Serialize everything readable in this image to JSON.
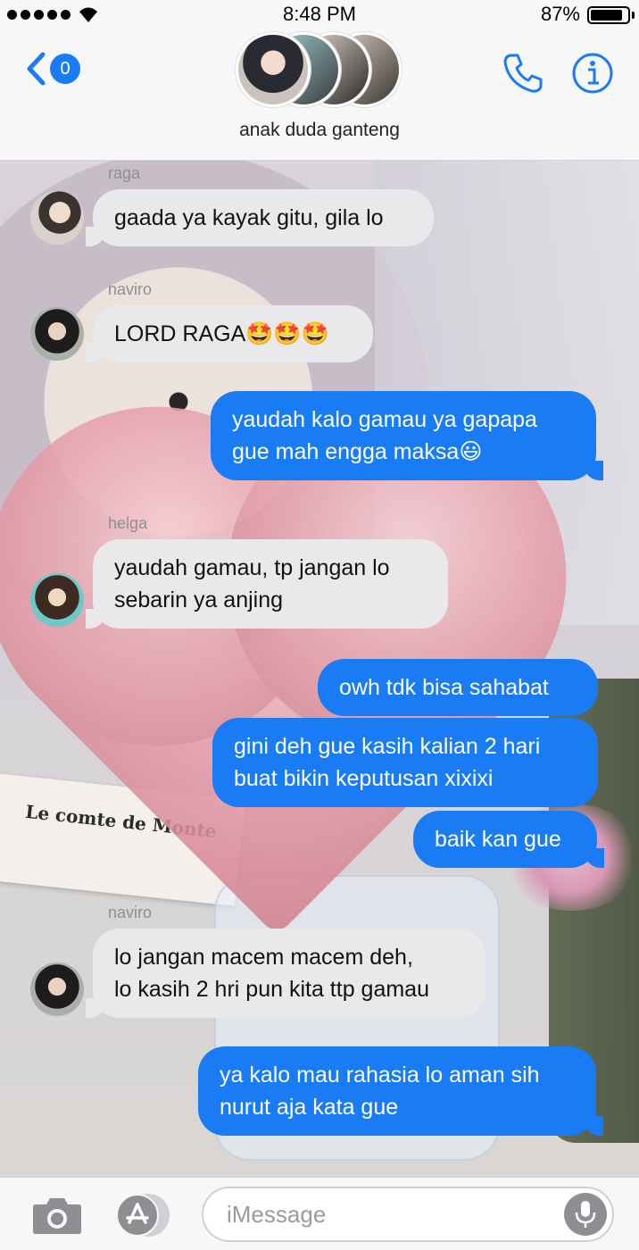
{
  "status": {
    "time": "8:48 PM",
    "battery_percent": "87%",
    "battery_level": 0.87
  },
  "header": {
    "back_badge": "0",
    "group_name": "anak duda ganteng"
  },
  "messages": [
    {
      "sender": "raga",
      "text": "gaada ya kayak gitu, gila lo",
      "side": "in"
    },
    {
      "sender": "naviro",
      "text": "LORD RAGA🤩🤩🤩",
      "side": "in"
    },
    {
      "text": "yaudah kalo gamau ya gapapa\ngue mah engga maksa😃",
      "side": "out"
    },
    {
      "sender": "helga",
      "text": "yaudah gamau, tp jangan lo\nsebarin ya anjing",
      "side": "in"
    },
    {
      "text": "owh tdk bisa sahabat",
      "side": "out"
    },
    {
      "text": "gini deh gue kasih kalian 2 hari\nbuat bikin keputusan xixixi",
      "side": "out"
    },
    {
      "text": "baik kan gue",
      "side": "out"
    },
    {
      "sender": "naviro",
      "text": "lo jangan macem macem deh,\nlo kasih 2 hri pun kita ttp gamau",
      "side": "in"
    },
    {
      "text": "ya kalo mau rahasia lo aman sih\nnurut aja kata gue",
      "side": "out"
    }
  ],
  "input": {
    "placeholder": "iMessage"
  },
  "background_text": "Le comte de Monte",
  "colors": {
    "accent": "#1a7cf5",
    "incoming_bubble": "#e9e9eb",
    "header_bg": "#f7f7f7"
  }
}
